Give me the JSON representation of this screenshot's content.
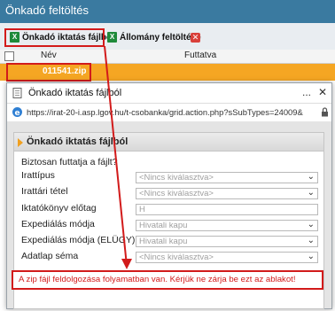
{
  "app": {
    "title": "Önkadó feltöltés"
  },
  "toolbar": {
    "upload_excel_label": "Önkadó iktatás fájlból",
    "upload_file_label": "Állomány feltöltése"
  },
  "grid": {
    "columns": [
      "Név",
      "Futtatva"
    ],
    "rows": [
      {
        "name": "011541.zip",
        "run": ""
      }
    ]
  },
  "popup": {
    "window_title": "Önkadó iktatás fájlból",
    "minimize_glyph": "...",
    "close_glyph": "✕",
    "url": "https://irat-20-i.asp.lgov.hu/t-csobanka/grid.action.php?sSubTypes=24009&",
    "panel_title": "Önkadó iktatás fájlból",
    "question": "Biztosan futtatja a fájlt?",
    "fields": [
      {
        "label": "Irattípus",
        "type": "select",
        "value": "<Nincs kiválasztva>"
      },
      {
        "label": "Irattári tétel",
        "type": "select",
        "value": "<Nincs kiválasztva>"
      },
      {
        "label": "Iktatókönyv előtag",
        "type": "input",
        "value": "H"
      },
      {
        "label": "Expediálás módja",
        "type": "select",
        "value": "Hivatali kapu"
      },
      {
        "label": "Expediálás módja (ELÜGY)",
        "type": "select",
        "value": "Hivatali kapu"
      },
      {
        "label": "Adatlap séma",
        "type": "select",
        "value": "<Nincs kiválasztva>"
      }
    ],
    "status_message": "A zip fájl feldolgozása folyamatban van. Kérjük ne zárja be ezt az ablakot!"
  },
  "colors": {
    "titlebar": "#3a7aa0",
    "selected_row": "#f5a623",
    "highlight_red": "#d21b1b"
  }
}
